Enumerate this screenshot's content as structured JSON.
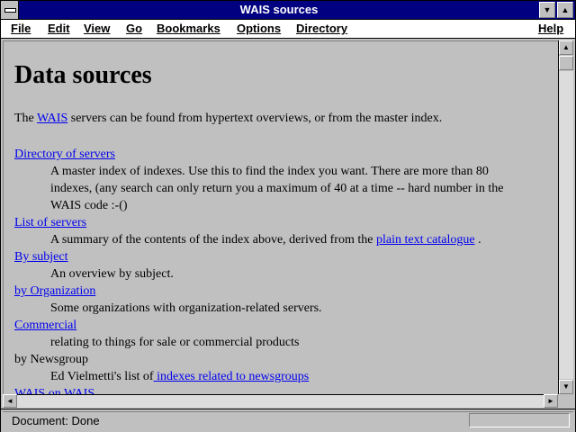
{
  "window": {
    "title": "WAIS sources"
  },
  "menu": {
    "items": [
      {
        "label": "File",
        "accel": "F"
      },
      {
        "label": "Edit",
        "accel": "E"
      },
      {
        "label": "View",
        "accel": "V"
      },
      {
        "label": "Go",
        "accel": "G"
      },
      {
        "label": "Bookmarks",
        "accel": "B"
      },
      {
        "label": "Options",
        "accel": "O"
      },
      {
        "label": "Directory",
        "accel": "D"
      },
      {
        "label": "Help",
        "accel": "H"
      }
    ]
  },
  "page": {
    "heading": "Data sources",
    "intro_before": "The ",
    "intro_link": "WAIS",
    "intro_after": " servers can be found from hypertext overviews, or from the master index.",
    "entries": [
      {
        "link": "Directory of servers",
        "desc_lines": [
          "A master index of indexes. Use this to find the index you want. There are more than 80",
          "indexes, (any search can only return you a maximum of 40 at a time -- hard number in the",
          "WAIS code :-()"
        ]
      },
      {
        "link": "List of servers",
        "desc_before": "A summary of the contents of the index above, derived from the ",
        "desc_link": "plain text catalogue",
        "desc_after": " ."
      },
      {
        "link": "By subject",
        "desc": "An overview by subject."
      },
      {
        "link": "by Organization",
        "desc": "Some organizations with organization-related servers."
      },
      {
        "link": "Commercial",
        "desc": "relating to things for sale or commercial products"
      },
      {
        "term": "by Newsgroup",
        "desc_before": "Ed Vielmetti's list of",
        "desc_link": " indexes related to newsgroups"
      },
      {
        "link": "WAIS on WAIS"
      }
    ]
  },
  "status": {
    "text": "Document: Done"
  },
  "colors": {
    "titlebar": "#000080",
    "link": "#0000ee",
    "background": "#c0c0c0"
  }
}
